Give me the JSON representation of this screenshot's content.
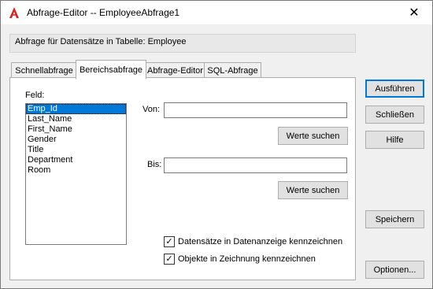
{
  "window": {
    "title": "Abfrage-Editor -- EmployeeAbfrage1",
    "close_glyph": "✕"
  },
  "info_bar": {
    "text": "Abfrage für Datensätze in Tabelle:  Employee"
  },
  "tabs": [
    {
      "label": "Schnellabfrage",
      "active": false
    },
    {
      "label": "Bereichsabfrage",
      "active": true
    },
    {
      "label": "Abfrage-Editor",
      "active": false
    },
    {
      "label": "SQL-Abfrage",
      "active": false
    }
  ],
  "panel": {
    "field_label": "Feld:",
    "fields": [
      "Emp_Id",
      "Last_Name",
      "First_Name",
      "Gender",
      "Title",
      "Department",
      "Room"
    ],
    "selected_field": "Emp_Id",
    "from_label": "Von:",
    "from_value": "",
    "to_label": "Bis:",
    "to_value": "",
    "find_values_label": "Werte suchen",
    "find_values_label_2": "Werte suchen",
    "checkbox_highlight_label": "Datensätze in Datenanzeige kennzeichnen",
    "checkbox_highlight_checked": true,
    "checkbox_objects_label": "Objekte in Zeichnung kennzeichnen",
    "checkbox_objects_checked": true,
    "check_glyph": "✓"
  },
  "buttons": {
    "execute": "Ausführen",
    "close": "Schließen",
    "help": "Hilfe",
    "save": "Speichern",
    "options": "Optionen..."
  }
}
